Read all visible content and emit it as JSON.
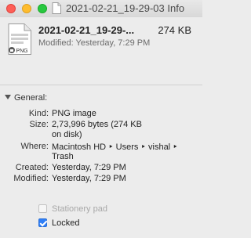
{
  "window": {
    "title": "2021-02-21_19-29-03 Info"
  },
  "header": {
    "file_name": "2021-02-21_19-29-...",
    "file_size": "274 KB",
    "modified": "Modified: Yesterday, 7:29 PM",
    "icon_badge": "PNG"
  },
  "general": {
    "heading": "General:",
    "rows": [
      {
        "label": "Kind:",
        "value": "PNG image"
      },
      {
        "label": "Size:",
        "value": "2,73,996 bytes (274 KB",
        "value2": "on disk)"
      },
      {
        "label": "Where:",
        "value": "Macintosh HD ‣ Users ‣ vishal ‣",
        "value2": "Trash"
      },
      {
        "label": "Created:",
        "value": "Yesterday, 7:29 PM"
      },
      {
        "label": "Modified:",
        "value": "Yesterday, 7:29 PM"
      }
    ]
  },
  "options": {
    "stationery_label": "Stationery pad",
    "locked_label": "Locked"
  }
}
